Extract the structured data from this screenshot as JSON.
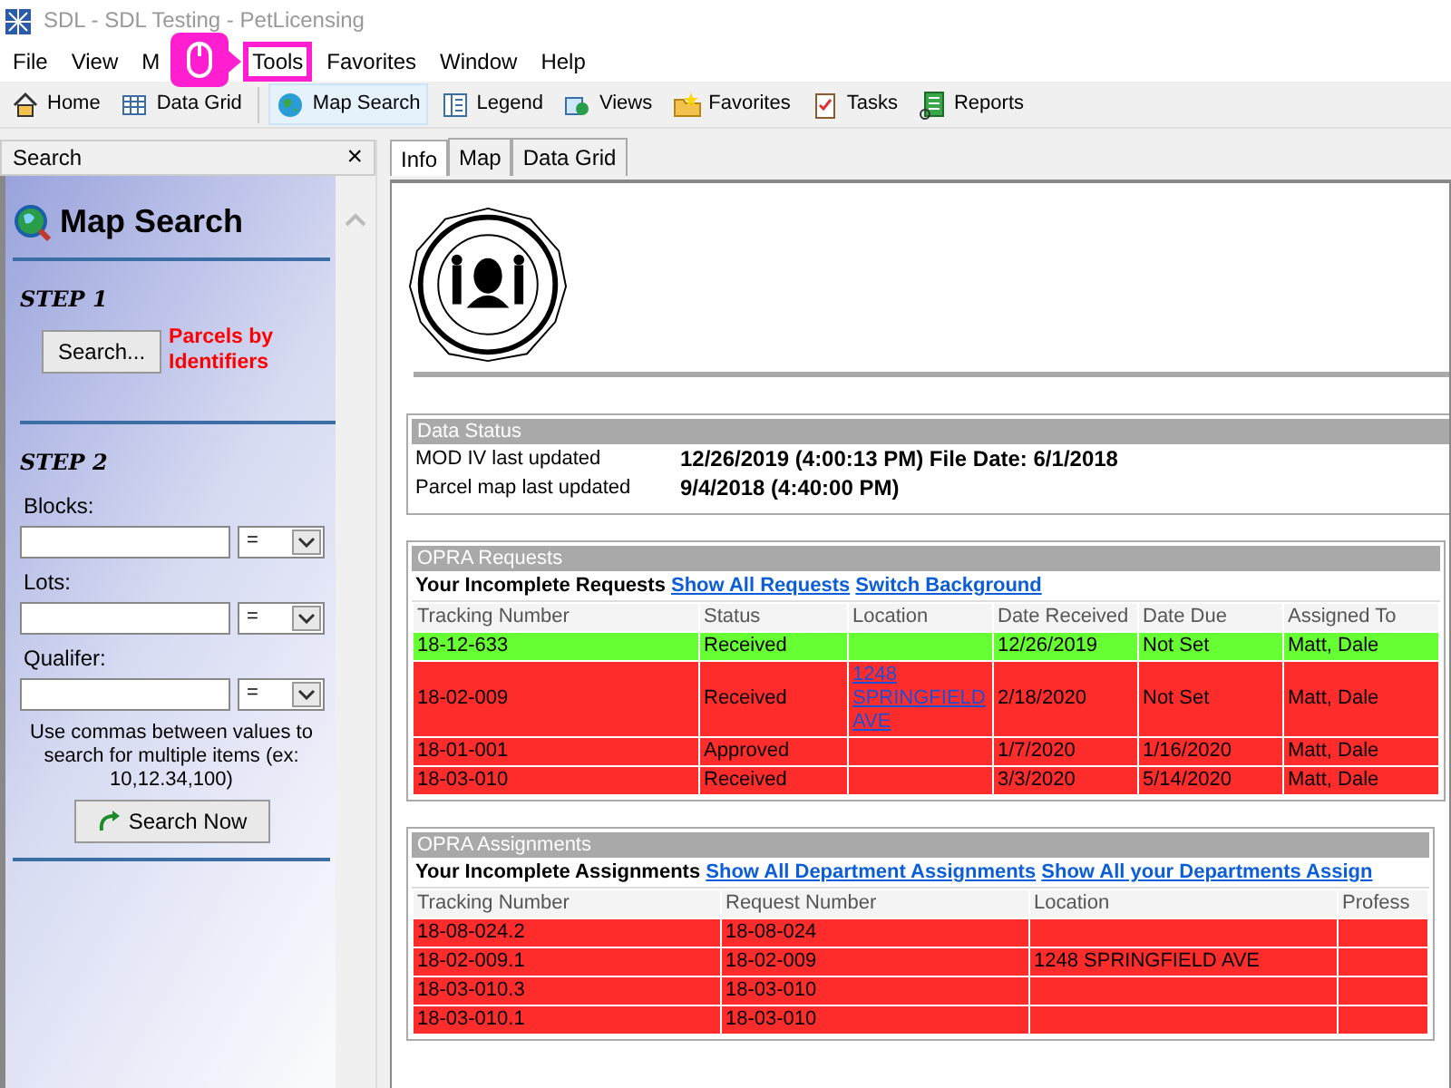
{
  "window": {
    "title": "SDL - SDL Testing - PetLicensing"
  },
  "menu": [
    {
      "label": "File",
      "highlighted": false
    },
    {
      "label": "View",
      "highlighted": false
    },
    {
      "label": "M",
      "highlighted": false
    },
    {
      "label": "Tools",
      "highlighted": true
    },
    {
      "label": "Favorites",
      "highlighted": false
    },
    {
      "label": "Window",
      "highlighted": false
    },
    {
      "label": "Help",
      "highlighted": false
    }
  ],
  "toolbar": [
    {
      "label": "Home",
      "selected": false
    },
    {
      "label": "Data Grid",
      "selected": false
    },
    {
      "label": "Map Search",
      "selected": true
    },
    {
      "label": "Legend",
      "selected": false
    },
    {
      "label": "Views",
      "selected": false
    },
    {
      "label": "Favorites",
      "selected": false
    },
    {
      "label": "Tasks",
      "selected": false
    },
    {
      "label": "Reports",
      "selected": false
    }
  ],
  "search_panel": {
    "title": "Search",
    "close": "×",
    "heading": "Map Search",
    "step1": {
      "label": "STEP 1",
      "button": "Search...",
      "note": "Parcels by Identifiers"
    },
    "step2": {
      "label": "STEP 2",
      "fields": [
        {
          "label": "Blocks:",
          "operator": "="
        },
        {
          "label": "Lots:",
          "operator": "="
        },
        {
          "label": "Qualifer:",
          "operator": "="
        }
      ],
      "hint": "Use commas between values to search for multiple items (ex: 10,12.34,100)",
      "button": "Search Now"
    }
  },
  "tabs": [
    {
      "label": "Info",
      "selected": true
    },
    {
      "label": "Map",
      "selected": false
    },
    {
      "label": "Data Grid",
      "selected": false
    }
  ],
  "data_status": {
    "title": "Data Status",
    "rows": [
      {
        "label": "MOD IV last updated",
        "value": "12/26/2019 (4:00:13 PM) File Date: 6/1/2018"
      },
      {
        "label": "Parcel map last updated",
        "value": "9/4/2018 (4:40:00 PM)"
      }
    ]
  },
  "requests": {
    "title": "OPRA Requests",
    "subtitle": "Your Incomplete Requests",
    "links": [
      "Show All Requests",
      "Switch Background"
    ],
    "columns": [
      "Tracking Number",
      "Status",
      "Location",
      "Date Received",
      "Date Due",
      "Assigned To"
    ],
    "rows": [
      {
        "color": "#66ff33",
        "cells": [
          "18-12-633",
          "Received",
          "",
          "12/26/2019",
          "Not Set",
          "Matt, Dale"
        ]
      },
      {
        "color": "#ff2c2c",
        "cells": [
          "18-02-009",
          "Received",
          "1248 SPRINGFIELD AVE",
          "2/18/2020",
          "Not Set",
          "Matt, Dale"
        ]
      },
      {
        "color": "#ff2c2c",
        "cells": [
          "18-01-001",
          "Approved",
          "",
          "1/7/2020",
          "1/16/2020",
          "Matt, Dale"
        ]
      },
      {
        "color": "#ff2c2c",
        "cells": [
          "18-03-010",
          "Received",
          "",
          "3/3/2020",
          "5/14/2020",
          "Matt, Dale"
        ]
      }
    ]
  },
  "assignments": {
    "title": "OPRA Assignments",
    "subtitle": "Your Incomplete Assignments",
    "links": [
      "Show All Department Assignments",
      "Show All your Departments Assign"
    ],
    "columns": [
      "Tracking Number",
      "Request Number",
      "Location",
      "Profess"
    ],
    "rows": [
      {
        "color": "#ff2c2c",
        "cells": [
          "18-08-024.2",
          "18-08-024",
          "",
          ""
        ]
      },
      {
        "color": "#ff2c2c",
        "cells": [
          "18-02-009.1",
          "18-02-009",
          "1248 SPRINGFIELD AVE",
          ""
        ]
      },
      {
        "color": "#ff2c2c",
        "cells": [
          "18-03-010.3",
          "18-03-010",
          "",
          ""
        ]
      },
      {
        "color": "#ff2c2c",
        "cells": [
          "18-03-010.1",
          "18-03-010",
          "",
          ""
        ]
      }
    ]
  }
}
